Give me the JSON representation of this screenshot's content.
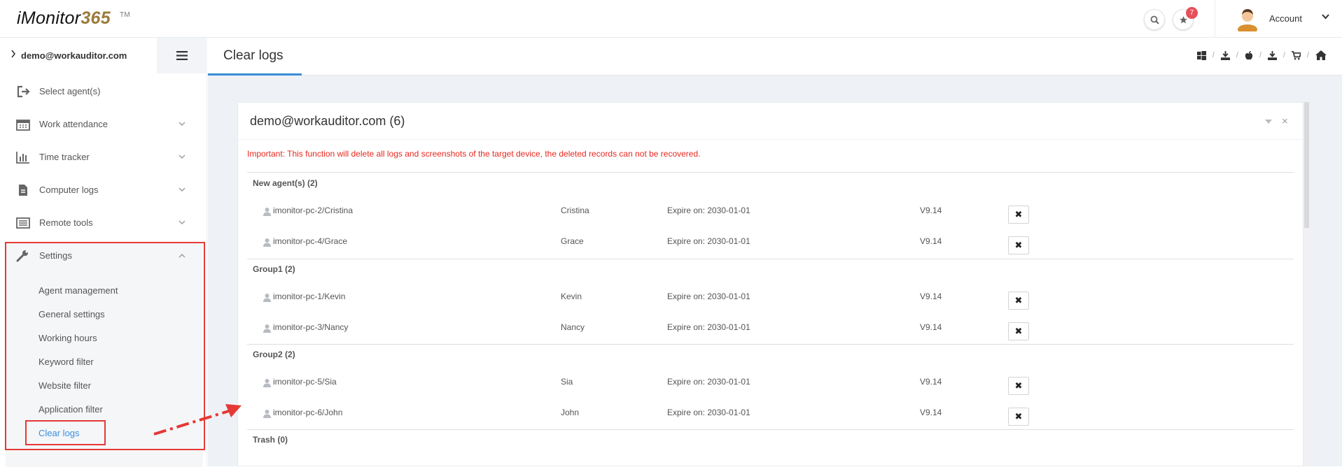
{
  "header": {
    "logo_text": "iMonitor",
    "logo_num": "365",
    "logo_tm": "TM",
    "notifications_count": "7",
    "account_label": "Account",
    "icons": [
      "search-icon",
      "star-icon",
      "avatar",
      "chevron-down-icon"
    ]
  },
  "sidebar": {
    "user_email": "demo@workauditor.com",
    "items": [
      {
        "label": "Select agent(s)",
        "icon": "sign-in-icon"
      },
      {
        "label": "Work attendance",
        "icon": "calendar-icon"
      },
      {
        "label": "Time tracker",
        "icon": "bar-chart-icon"
      },
      {
        "label": "Computer logs",
        "icon": "file-icon"
      },
      {
        "label": "Remote tools",
        "icon": "list-icon"
      },
      {
        "label": "Settings",
        "icon": "wrench-icon"
      }
    ],
    "settings_sub": [
      "Agent management",
      "General settings",
      "Working hours",
      "Keyword filter",
      "Website filter",
      "Application filter",
      "Clear logs"
    ]
  },
  "page": {
    "title": "Clear logs",
    "toolbar_icons": [
      "windows-icon",
      "download-icon",
      "apple-icon",
      "download-icon",
      "cart-icon",
      "home-icon"
    ],
    "toolbar_sep": "/"
  },
  "portlet": {
    "title": "demo@workauditor.com (6)",
    "warning": "Important: This function will delete all logs and screenshots of the target device, the deleted records can not be recovered.",
    "close_label": "×",
    "delete_label": "✖",
    "expire_prefix": "Expire on: ",
    "groups": [
      {
        "name": "New agent(s) (2)",
        "agents": [
          {
            "pc": "imonitor-pc-2/Cristina",
            "user": "Cristina",
            "expire": "Expire on: 2030-01-01",
            "version": "V9.14"
          },
          {
            "pc": "imonitor-pc-4/Grace",
            "user": "Grace",
            "expire": "Expire on: 2030-01-01",
            "version": "V9.14"
          }
        ]
      },
      {
        "name": "Group1 (2)",
        "agents": [
          {
            "pc": "imonitor-pc-1/Kevin",
            "user": "Kevin",
            "expire": "Expire on: 2030-01-01",
            "version": "V9.14"
          },
          {
            "pc": "imonitor-pc-3/Nancy",
            "user": "Nancy",
            "expire": "Expire on: 2030-01-01",
            "version": "V9.14"
          }
        ]
      },
      {
        "name": "Group2 (2)",
        "agents": [
          {
            "pc": "imonitor-pc-5/Sia",
            "user": "Sia",
            "expire": "Expire on: 2030-01-01",
            "version": "V9.14"
          },
          {
            "pc": "imonitor-pc-6/John",
            "user": "John",
            "expire": "Expire on: 2030-01-01",
            "version": "V9.14"
          }
        ]
      },
      {
        "name": "Trash (0)",
        "agents": []
      }
    ]
  },
  "colors": {
    "accent": "#3a8ed8",
    "warning": "#e7281f",
    "annotation": "#e53935",
    "badge": "#e7505a",
    "logo_num": "#9a7b3a"
  }
}
